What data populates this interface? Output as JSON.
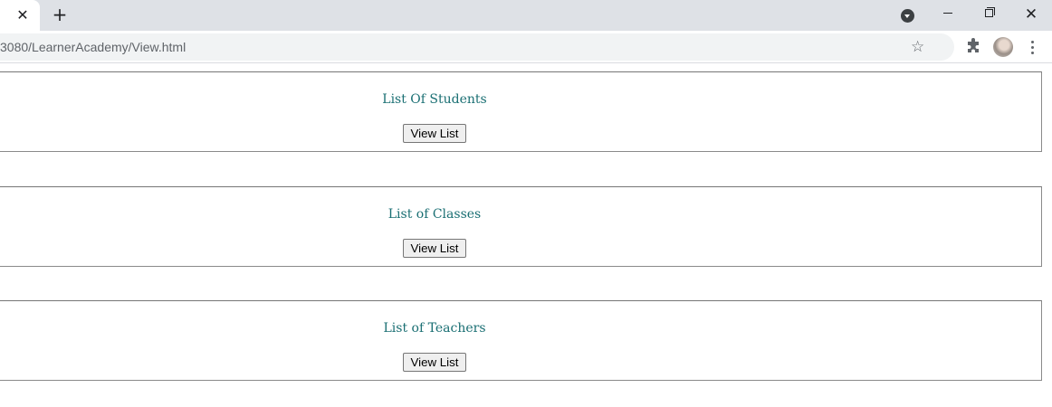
{
  "browser": {
    "url": "3080/LearnerAcademy/View.html",
    "icons": {
      "tab_close": "close-icon",
      "new_tab": "plus-icon",
      "tab_search": "tab-search-icon",
      "minimize": "minimize-icon",
      "restore": "restore-icon",
      "close": "close-icon",
      "bookmark": "star-icon",
      "extensions": "puzzle-icon",
      "profile": "avatar",
      "menu": "kebab-menu-icon"
    }
  },
  "sections": [
    {
      "title": "List Of Students",
      "button_label": "View List"
    },
    {
      "title": "List of Classes",
      "button_label": "View List"
    },
    {
      "title": "List of Teachers",
      "button_label": "View List"
    }
  ],
  "colors": {
    "section_title": "#1a6f73",
    "tabstrip_bg": "#dee1e6"
  }
}
